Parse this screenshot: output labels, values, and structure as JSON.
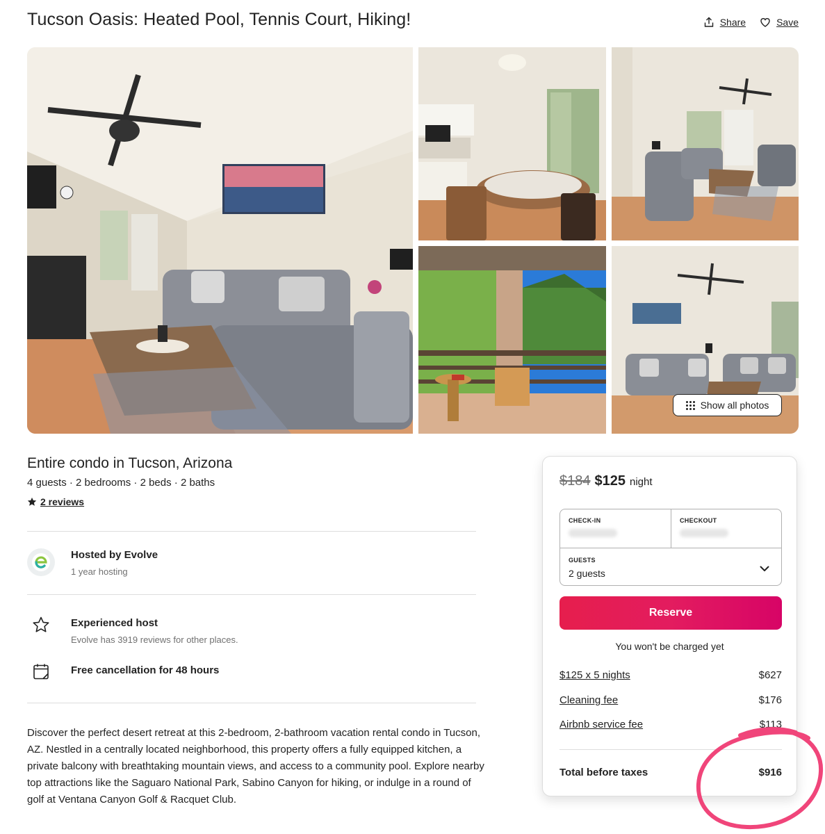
{
  "listing": {
    "title": "Tucson Oasis: Heated Pool, Tennis Court, Hiking!",
    "share_label": "Share",
    "save_label": "Save",
    "show_all_photos_label": "Show all photos",
    "subtitle": "Entire condo in Tucson, Arizona",
    "specs": "4 guests · 2 bedrooms · 2 beds · 2 baths",
    "reviews_label": "2 reviews"
  },
  "host": {
    "name": "Hosted by Evolve",
    "tenure": "1 year hosting"
  },
  "highlights": [
    {
      "icon": "star-outline-icon",
      "title": "Experienced host",
      "subtitle": "Evolve has 3919 reviews for other places."
    },
    {
      "icon": "calendar-icon",
      "title": "Free cancellation for 48 hours",
      "subtitle": ""
    }
  ],
  "description": "Discover the perfect desert retreat at this 2-bedroom, 2-bathroom vacation rental condo in Tucson, AZ. Nestled in a centrally located neighborhood, this property offers a fully equipped kitchen, a private balcony with breathtaking mountain views, and access to a community pool. Explore nearby top attractions like the Saguaro National Park, Sabino Canyon for hiking, or indulge in a round of golf at Ventana Canyon Golf & Racquet Club.",
  "booking": {
    "original_price": "$184",
    "price": "$125",
    "per": "night",
    "checkin_label": "CHECK-IN",
    "checkout_label": "CHECKOUT",
    "guests_label": "GUESTS",
    "guests_value": "2 guests",
    "reserve_label": "Reserve",
    "not_charged": "You won't be charged yet",
    "fees": [
      {
        "label": "$125 x 5 nights",
        "amount": "$627"
      },
      {
        "label": "Cleaning fee",
        "amount": "$176"
      },
      {
        "label": "Airbnb service fee",
        "amount": "$113"
      }
    ],
    "total_label": "Total before taxes",
    "total_amount": "$916"
  },
  "colors": {
    "accent": "#e31c5f",
    "annotation": "#f0457a",
    "text": "#222222",
    "muted": "#717171"
  }
}
